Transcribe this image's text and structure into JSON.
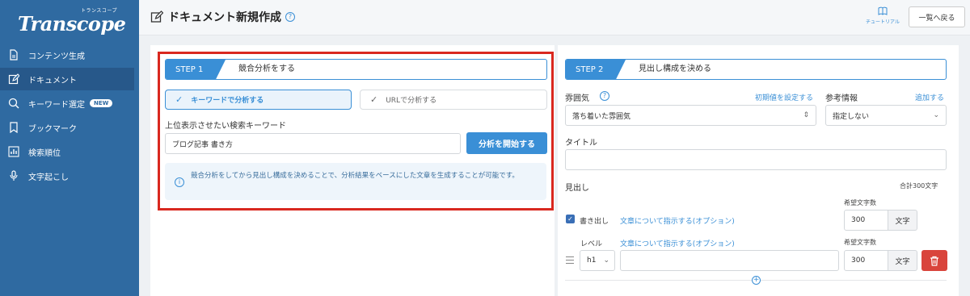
{
  "sidebar": {
    "logo_sub": "トランスコープ",
    "logo": "Transcope",
    "items": [
      {
        "label": "コンテンツ生成",
        "icon": "file-icon"
      },
      {
        "label": "ドキュメント",
        "icon": "edit-icon"
      },
      {
        "label": "キーワード選定",
        "icon": "search-icon",
        "badge": "NEW"
      },
      {
        "label": "ブックマーク",
        "icon": "bookmark-icon"
      },
      {
        "label": "検索順位",
        "icon": "chart-icon"
      },
      {
        "label": "文字起こし",
        "icon": "mic-icon"
      }
    ]
  },
  "header": {
    "title": "ドキュメント新規作成",
    "help": "?",
    "tutorial": "チュートリアル",
    "back_button": "一覧へ戻る"
  },
  "step1": {
    "step_label": "STEP 1",
    "title": "競合分析をする",
    "option_keyword": "キーワードで分析する",
    "option_url": "URLで分析する",
    "check": "✓",
    "keyword_label": "上位表示させたい検索キーワード",
    "keyword_value": "ブログ記事 書き方",
    "start_button": "分析を開始する",
    "info": "競合分析をしてから見出し構成を決めることで、分析結果をベースにした文章を生成することが可能です。"
  },
  "step2": {
    "step_label": "STEP 2",
    "title": "見出し構成を決める",
    "tone_label": "雰囲気",
    "tone_reset": "初期値を設定する",
    "tone_value": "落ち着いた雰囲気",
    "ref_label": "参考情報",
    "ref_add": "追加する",
    "ref_value": "指定しない",
    "title_label": "タイトル",
    "title_value": "",
    "heading_label": "見出し",
    "total_chars": "合計300文字",
    "desired_chars_label_1": "希望文字数",
    "intro_label": "書き出し",
    "instruction_link_1": "文章について指示する(オプション)",
    "chars_value_1": "300",
    "unit_1": "文字",
    "level_label": "レベル",
    "instruction_link_2": "文章について指示する(オプション)",
    "desired_chars_label_2": "希望文字数",
    "level_value": "h1",
    "heading_value": "",
    "chars_value_2": "300",
    "unit_2": "文字"
  }
}
